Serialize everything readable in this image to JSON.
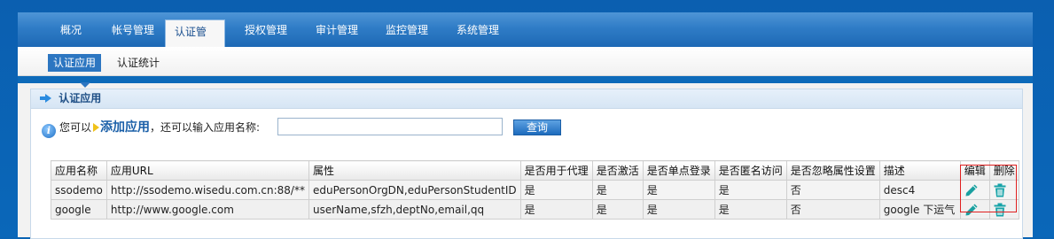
{
  "main_nav": {
    "tabs": [
      "概况",
      "帐号管理",
      "认证管理",
      "授权管理",
      "审计管理",
      "监控管理",
      "系统管理"
    ],
    "active": "认证管理"
  },
  "sub_nav": {
    "tabs": [
      "认证应用",
      "认证统计"
    ],
    "active": "认证应用"
  },
  "panel": {
    "title": "认证应用"
  },
  "toolbar": {
    "prefix": "您可以",
    "add_label": "添加应用",
    "suffix": "，还可以输入应用名称:",
    "search_value": "",
    "query_label": "查询"
  },
  "table": {
    "headers": [
      "应用名称",
      "应用URL",
      "属性",
      "是否用于代理",
      "是否激活",
      "是否单点登录",
      "是否匿名访问",
      "是否忽略属性设置",
      "描述",
      "编辑",
      "删除"
    ],
    "rows": [
      [
        "ssodemo",
        "http://ssodemo.wisedu.com.cn:88/**",
        "eduPersonOrgDN,eduPersonStudentID",
        "是",
        "是",
        "是",
        "是",
        "否",
        "desc4"
      ],
      [
        "google",
        "http://www.google.com",
        "userName,sfzh,deptNo,email,qq",
        "是",
        "是",
        "是",
        "是",
        "否",
        "google 下运气"
      ]
    ]
  },
  "colors": {
    "accent": "#2c76c1",
    "edit_icon": "#1aa0a0",
    "delete_icon": "#17a3a8",
    "highlight": "#e02020"
  }
}
